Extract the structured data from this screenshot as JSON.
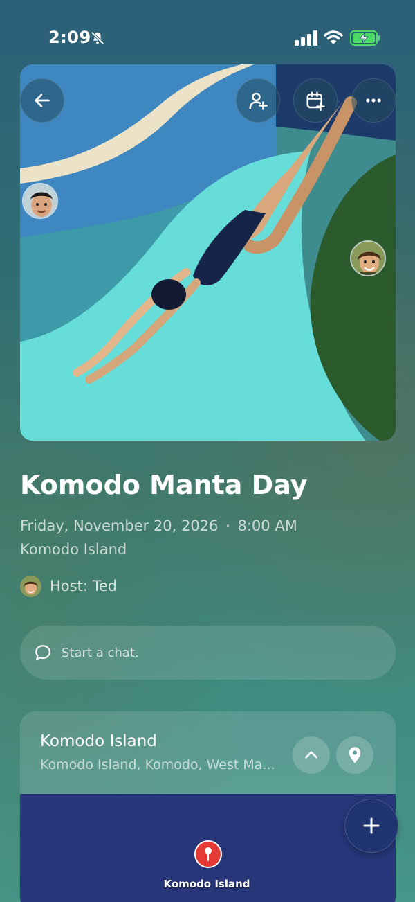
{
  "status_bar": {
    "time": "2:09",
    "icons": [
      "bell-slash-icon",
      "cellular-signal-icon",
      "wifi-icon",
      "battery-charging-icon"
    ],
    "battery_color": "#4cd964"
  },
  "header_actions": {
    "back_icon": "arrow-left-icon",
    "invite_icon": "user-plus-icon",
    "calendar_icon": "calendar-plus-icon",
    "more_icon": "ellipsis-icon"
  },
  "event": {
    "title": "Komodo Manta Day",
    "date": "Friday, November 20, 2026",
    "separator": "·",
    "time": "8:00 AM",
    "location": "Komodo Island",
    "host_label": "Host: Ted"
  },
  "chat": {
    "placeholder": "Start a chat.",
    "icon": "chat-bubble-icon"
  },
  "location_card": {
    "name": "Komodo Island",
    "address": "Komodo Island, Komodo, West Ma...",
    "map_label": "Komodo Island",
    "collapse_icon": "chevron-up-icon",
    "pin_icon": "map-pin-icon",
    "map_color": "#263679",
    "pin_color": "#e53935"
  },
  "fab": {
    "icon": "plus-icon"
  },
  "colors": {
    "background_top": "#2c5f78",
    "background_bottom": "#47968a",
    "pool_light": "#66ddd8",
    "pool_mid": "#3d9aa8",
    "sky_blue": "#3f87c0",
    "grass": "#2b5a2c",
    "swimsuit": "#16244a"
  }
}
